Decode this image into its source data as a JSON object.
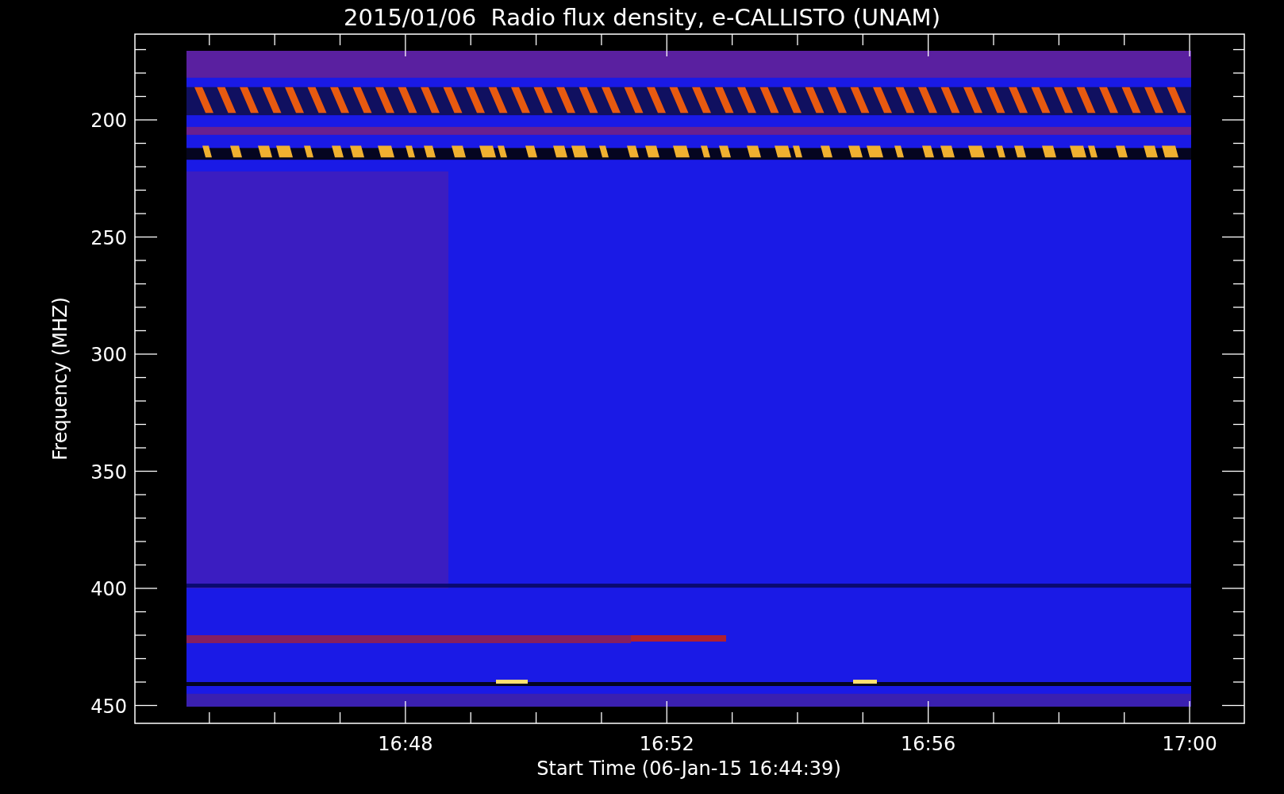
{
  "title": "2015/01/06  Radio flux density, e-CALLISTO (UNAM)",
  "y_axis": {
    "label": "Frequency (MHZ)",
    "ticks": [
      "200",
      "250",
      "300",
      "350",
      "400",
      "450"
    ]
  },
  "x_axis": {
    "label": "Start Time (06-Jan-15 16:44:39)",
    "ticks": [
      "16:48",
      "16:52",
      "16:56",
      "17:00"
    ]
  }
}
